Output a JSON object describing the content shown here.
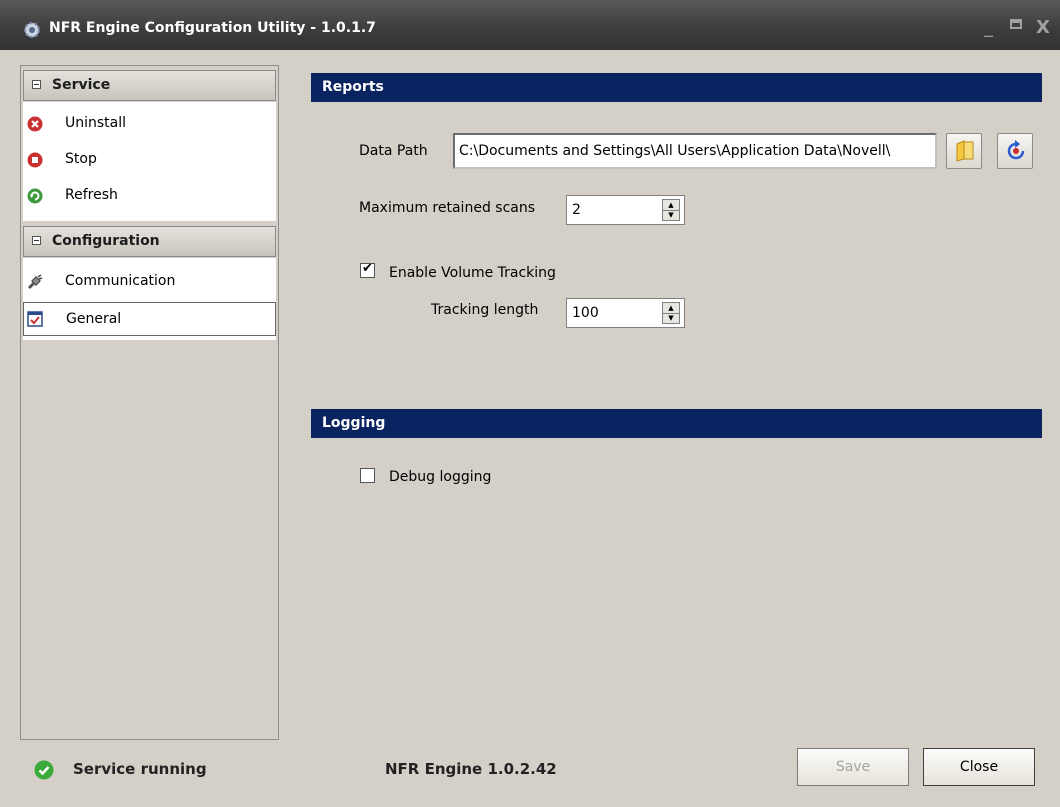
{
  "window": {
    "title": "NFR Engine Configuration Utility - 1.0.1.7",
    "controls": {
      "minimize": "_",
      "close": "X"
    }
  },
  "sidebar": {
    "service": {
      "header": "Service",
      "items": [
        {
          "label": "Uninstall",
          "icon": "uninstall-icon"
        },
        {
          "label": "Stop",
          "icon": "stop-icon"
        },
        {
          "label": "Refresh",
          "icon": "refresh-icon"
        }
      ]
    },
    "configuration": {
      "header": "Configuration",
      "items": [
        {
          "label": "Communication",
          "icon": "communication-icon"
        },
        {
          "label": "General",
          "icon": "general-icon",
          "selected": true
        }
      ]
    }
  },
  "reports": {
    "title": "Reports",
    "data_path_label": "Data Path",
    "data_path_value": "C:\\Documents and Settings\\All Users\\Application Data\\Novell\\",
    "max_scans_label": "Maximum retained scans",
    "max_scans_value": "2",
    "volume_tracking_label": "Enable Volume Tracking",
    "volume_tracking_checked": true,
    "tracking_length_label": "Tracking length",
    "tracking_length_value": "100"
  },
  "logging": {
    "title": "Logging",
    "debug_label": "Debug logging",
    "debug_checked": false
  },
  "status": {
    "text": "Service running",
    "engine_version": "NFR Engine 1.0.2.42"
  },
  "buttons": {
    "save": "Save",
    "close": "Close"
  },
  "colors": {
    "section_bar": "#0a2462",
    "titlebar": "#3c3c3c",
    "background": "#d4d0c8"
  }
}
